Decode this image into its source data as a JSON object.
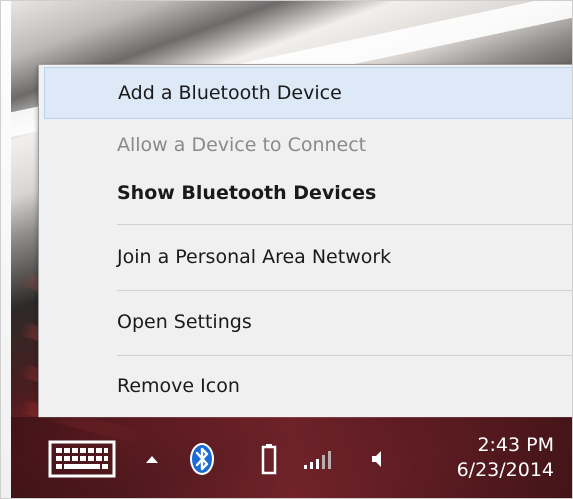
{
  "menu": {
    "items": [
      {
        "label": "Add a Bluetooth Device"
      },
      {
        "label": "Allow a Device to Connect"
      },
      {
        "label": "Show Bluetooth Devices"
      },
      {
        "label": "Join a Personal Area Network"
      },
      {
        "label": "Open Settings"
      },
      {
        "label": "Remove Icon"
      }
    ]
  },
  "taskbar": {
    "icons": [
      "keyboard-icon",
      "show-hidden-icons-arrow",
      "bluetooth-icon",
      "battery-icon",
      "network-signal-icon",
      "volume-icon"
    ],
    "clock": {
      "time": "2:43 PM",
      "date": "6/23/2014"
    }
  },
  "colors": {
    "menu_background": "#f0f0f0",
    "hover_highlight": "#dde9f7",
    "hover_border": "#b9d2ef",
    "disabled_text": "#8a8a8a",
    "bluetooth_blue": "#1b6ad6"
  }
}
